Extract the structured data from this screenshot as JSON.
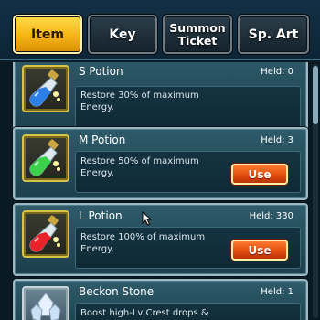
{
  "tabs": [
    {
      "id": "item",
      "label": "Item",
      "active": true
    },
    {
      "id": "key",
      "label": "Key",
      "active": false
    },
    {
      "id": "summon_ticket",
      "label": "Summon\nTicket",
      "active": false
    },
    {
      "id": "sp_art",
      "label": "Sp. Art",
      "active": false
    }
  ],
  "items": [
    {
      "name": "S Potion",
      "held": "Held: 0",
      "description": "Restore 30% of maximum Energy.",
      "icon": "blue-potion-icon",
      "has_use": false
    },
    {
      "name": "M Potion",
      "held": "Held: 3",
      "description": "Restore 50% of maximum Energy.",
      "icon": "green-potion-icon",
      "has_use": true,
      "use_label": "Use"
    },
    {
      "name": "L Potion",
      "held": "Held: 330",
      "description": "Restore 100% of maximum Energy.",
      "icon": "red-potion-icon",
      "has_use": true,
      "use_label": "Use"
    },
    {
      "name": "Beckon Stone",
      "held": "Held: 1",
      "description": "Boost high-Lv Crest drops &",
      "icon": "crystal-stone-icon",
      "has_use": false
    }
  ],
  "colors": {
    "active_tab": "#f5b414",
    "use_button": "#e04a0c",
    "card_border": "#9fb9c4",
    "background": "#0c1c28"
  }
}
